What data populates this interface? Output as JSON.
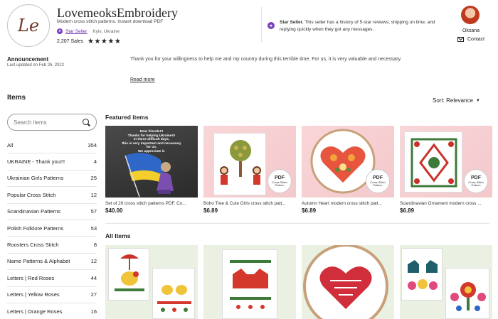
{
  "shop": {
    "logo_initials": "Le",
    "name": "LovemeoksEmbroidery",
    "tagline": "Modern cross stitch patterns. Instant download PDF",
    "star_seller_label": "Star Seller",
    "location": "Kyiv, Ukraine",
    "sales": "2,207 Sales",
    "rating_stars": "★★★★★"
  },
  "star_seller_info": {
    "title": "Star Seller.",
    "text": "This seller has a history of 5-star reviews, shipping on time, and replying quickly when they got any messages."
  },
  "owner": {
    "name": "Oksana",
    "contact_label": "Contact"
  },
  "announcement": {
    "title": "Announcement",
    "updated": "Last updated on Feb 26, 2022",
    "text": "Thank you for your willingness to help me and my country during this terrible time. For us, it is very valuable and necessary.",
    "read_more": "Read more"
  },
  "items": {
    "title": "Items",
    "sort_label": "Sort: Relevance",
    "search_placeholder": "Search items",
    "categories": [
      {
        "label": "All",
        "count": "354"
      },
      {
        "label": "UKRAINE - Thank you!!!",
        "count": "4"
      },
      {
        "label": "Ukrainian Girls Patterns",
        "count": "25"
      },
      {
        "label": "Popular Cross Stitch",
        "count": "12"
      },
      {
        "label": "Scandinavian Patterns",
        "count": "57"
      },
      {
        "label": "Polish Folklore Patterns",
        "count": "53"
      },
      {
        "label": "Roosters Cross Stitch",
        "count": "8"
      },
      {
        "label": "Name Patterns & Alphabet",
        "count": "12"
      },
      {
        "label": "Letters | Red Roses",
        "count": "44"
      },
      {
        "label": "Letters | Yellow Roses",
        "count": "27"
      },
      {
        "label": "Letters | Orange Roses",
        "count": "16"
      }
    ]
  },
  "featured": {
    "title": "Featured items",
    "products": [
      {
        "title": "Set of 20 cross stitch patterns PDF. Co...",
        "price": "$40.00"
      },
      {
        "title": "Boho Tree & Cute Girls cross stitch patt...",
        "price": "$6.89"
      },
      {
        "title": "Autumn Heart modern cross stitch patt...",
        "price": "$6.89"
      },
      {
        "title": "Scandinavian Ornament modern cross ...",
        "price": "$6.89"
      }
    ],
    "dark_card_text": "Dear friends!!!\nThanks for helping Ukraine!!!\nIn these difficult days,\nthis is very important and necessary for us.\nWe appreciate it.",
    "pdf_badge_top": "PDF",
    "pdf_badge_bottom": "Cross Stitch Pattern"
  },
  "all_items": {
    "title": "All Items"
  }
}
